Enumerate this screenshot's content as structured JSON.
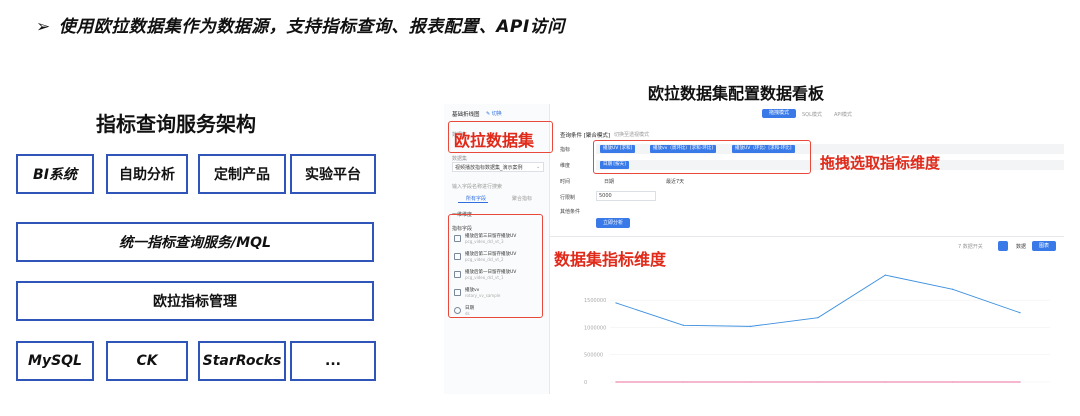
{
  "heading": {
    "arrow": "➢",
    "text": "使用欧拉数据集作为数据源，支持指标查询、报表配置、API访问"
  },
  "architecture": {
    "title": "指标查询服务架构",
    "row1": [
      "BI系统",
      "自助分析",
      "定制产品",
      "实验平台"
    ],
    "service": "统一指标查询服务/MQL",
    "management": "欧拉指标管理",
    "row4": [
      "MySQL",
      "CK",
      "StarRocks",
      "..."
    ]
  },
  "dashboard": {
    "title": "欧拉数据集配置数据看板",
    "annotations": {
      "dataset": "欧拉数据集",
      "drag": "拖拽选取指标维度",
      "dataset_metrics": "数据集指标维度"
    },
    "ui": {
      "page_title": "基础折线图",
      "edit_tag": "✎ 切换",
      "dataset_label": "数据集",
      "dataset_value": "视频播放指标数据集_演示案例",
      "search_placeholder": "输入字段名称进行搜索",
      "tab_dims": "所有字段",
      "tab_metrics": "聚合指标",
      "section_dims": "一维维度",
      "section_metrics": "指标字段",
      "items": [
        {
          "name": "播放后第三日留存播放UV",
          "sub": "pcg_video_dcl_vt_3"
        },
        {
          "name": "播放后第二日留存播放UV",
          "sub": "pcg_video_dcl_vt_2"
        },
        {
          "name": "播放后第一日留存播放UV",
          "sub": "pcg_video_dcl_vt_1"
        },
        {
          "name": "播放vv",
          "sub": "rotary_vv_sample"
        },
        {
          "name": "日期",
          "sub": "ds"
        }
      ],
      "mode_tabs": [
        "拖拽模式",
        "SQL模式",
        "API模式"
      ],
      "query_label": "查询条件 [聚合模式]",
      "query_switch": "切换至透视模式",
      "metric_label": "指标",
      "metric_chips": [
        "播放UV [求和]",
        "播放vv（周环比）[求和-环比]",
        "播放UV（环比）[求和-环比]"
      ],
      "dimension_label": "维度",
      "dimension_chips": [
        "日期 [按天]"
      ],
      "time_label": "时间",
      "time_value": "日期",
      "time_range": "最近7天",
      "limit_label": "行限制",
      "limit_value": "5000",
      "other_label": "其他条件",
      "query_button": "立即分析",
      "chart_toolbar": "7 数据开关",
      "btn_data": "数据",
      "btn_chart": "图表"
    }
  },
  "chart_data": {
    "type": "line",
    "y_ticks": [
      "1500000",
      "1000000",
      "500000",
      "0"
    ],
    "series": [
      {
        "color": "#3b8fe0",
        "values": [
          1450000,
          1040000,
          1020000,
          1180000,
          1960000,
          1700000,
          1270000
        ]
      },
      {
        "color": "#e86f9c",
        "values": [
          0,
          0,
          0,
          0,
          0,
          0,
          0
        ]
      }
    ],
    "ylim": [
      0,
      2200000
    ]
  }
}
